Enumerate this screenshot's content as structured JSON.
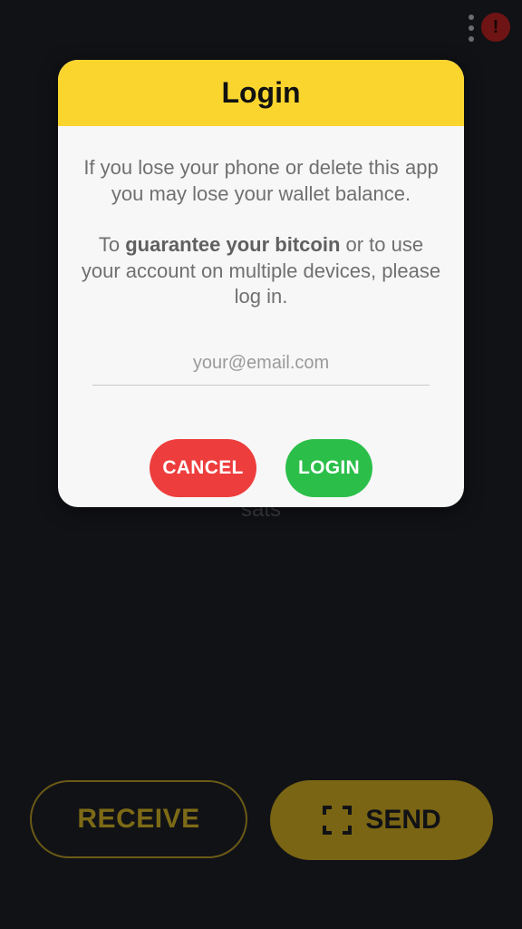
{
  "header": {
    "menu_icon": "more-vert-icon",
    "alert_icon": "alert-icon",
    "alert_symbol": "!"
  },
  "background": {
    "unit_label": "sats"
  },
  "dialog": {
    "title": "Login",
    "message1": "If you lose your phone or delete this app you may lose your wallet balance.",
    "message2_prefix": "To ",
    "message2_bold": "guarantee your bitcoin",
    "message2_suffix": " or to use your account on multiple devices, please log in.",
    "email_placeholder": "your@email.com",
    "email_value": "",
    "cancel_label": "CANCEL",
    "login_label": "LOGIN"
  },
  "actions": {
    "receive_label": "RECEIVE",
    "send_label": "SEND",
    "send_icon": "qr-scan-icon"
  },
  "colors": {
    "background": "#111216",
    "dialog_header": "#fad52e",
    "cancel": "#ee3d3d",
    "login": "#2bbf4a",
    "accent_dim": "#7a6514"
  }
}
